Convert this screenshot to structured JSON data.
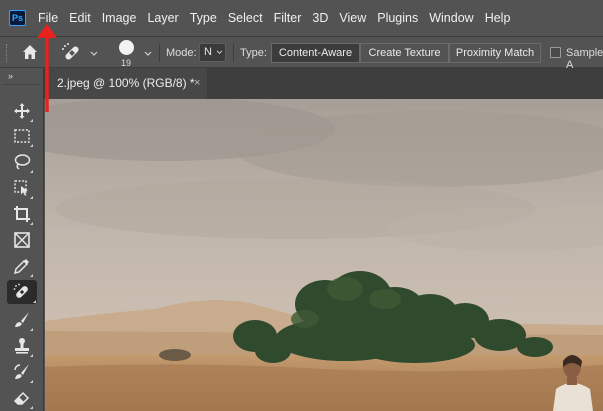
{
  "app": {
    "logo": "Ps"
  },
  "menu": [
    "File",
    "Edit",
    "Image",
    "Layer",
    "Type",
    "Select",
    "Filter",
    "3D",
    "View",
    "Plugins",
    "Window",
    "Help"
  ],
  "options": {
    "brush_size": "19",
    "mode_label": "Mode:",
    "mode_value": "N",
    "type_label": "Type:",
    "type_buttons": [
      "Content-Aware",
      "Create Texture",
      "Proximity Match"
    ],
    "type_selected": "Content-Aware",
    "sample_all_label": "Sample A",
    "icons": {
      "home": "home-icon",
      "tool": "spot-healing-brush-icon"
    }
  },
  "document": {
    "tab_title": "2.jpeg @ 100% (RGB/8) *",
    "close_symbol": "×"
  },
  "toolbar": {
    "collapse_symbol": "»",
    "tools": [
      "move",
      "rectangular-marquee",
      "lasso",
      "object-selection",
      "crop",
      "frame",
      "eyedropper",
      "spot-healing-brush",
      "brush",
      "clone-stamp",
      "history-brush",
      "eraser"
    ],
    "active_tool": "spot-healing-brush"
  },
  "annotation": {
    "color": "#e8231f"
  },
  "colors": {
    "panel": "#535353",
    "dark": "#3e3e3e",
    "accent": "#31a8ff"
  }
}
